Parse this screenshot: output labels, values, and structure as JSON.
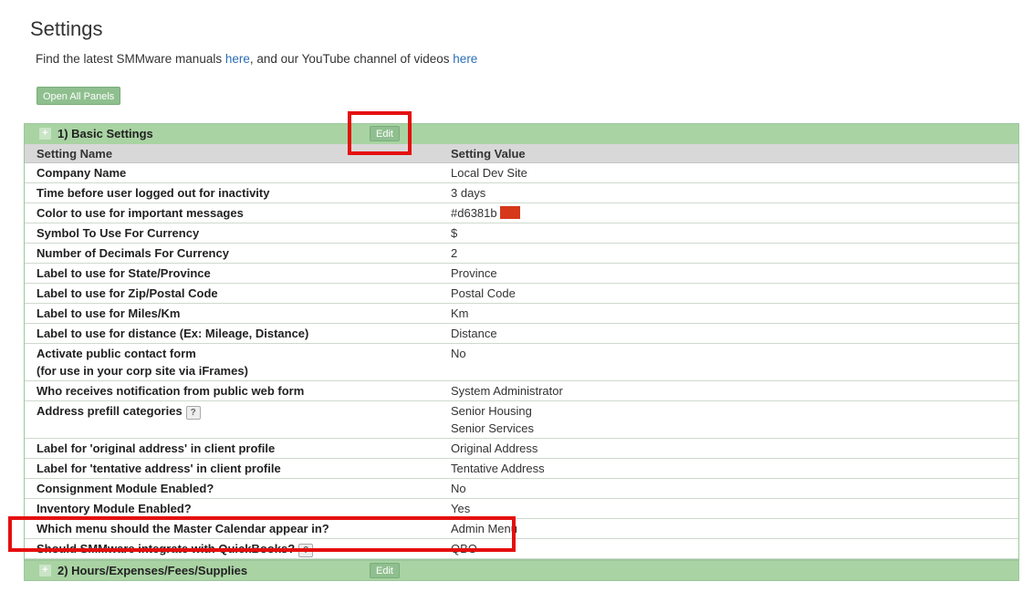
{
  "page": {
    "title": "Settings",
    "intro_text": "Find the latest SMMware manuals ",
    "link1": "here",
    "intro_mid": ", and our YouTube channel of videos ",
    "link2": "here",
    "open_all": "Open All Panels"
  },
  "panel1": {
    "title": "1) Basic Settings",
    "toggle": "+",
    "edit_label": "Edit",
    "col_name": "Setting Name",
    "col_value": "Setting Value",
    "rows": [
      {
        "name": "Company Name",
        "value": "Local Dev Site"
      },
      {
        "name": "Time before user logged out for inactivity",
        "value": "3 days"
      },
      {
        "name": "Color to use for important messages",
        "value": "#d6381b"
      },
      {
        "name": "Symbol To Use For Currency",
        "value": "$"
      },
      {
        "name": "Number of Decimals For Currency",
        "value": "2"
      },
      {
        "name": "Label to use for State/Province",
        "value": "Province"
      },
      {
        "name": "Label to use for Zip/Postal Code",
        "value": "Postal Code"
      },
      {
        "name": "Label to use for Miles/Km",
        "value": "Km"
      },
      {
        "name": "Label to use for distance (Ex: Mileage, Distance)",
        "value": "Distance"
      },
      {
        "name": "Activate public contact form",
        "name2": "(for use in your corp site via iFrames)",
        "value": "No"
      },
      {
        "name": "Who receives notification from public web form",
        "value": "System Administrator"
      },
      {
        "name": "Address prefill categories",
        "help": "?",
        "value": "Senior Housing",
        "value2": "Senior Services"
      },
      {
        "name": "Label for 'original address' in client profile",
        "value": "Original Address"
      },
      {
        "name": "Label for 'tentative address' in client profile",
        "value": "Tentative Address"
      },
      {
        "name": "Consignment Module Enabled?",
        "value": "No"
      },
      {
        "name": "Inventory Module Enabled?",
        "value": "Yes"
      },
      {
        "name": "Which menu should the Master Calendar appear in?",
        "value": "Admin Menu"
      },
      {
        "name": "Should SMMware integrate with QuickBooks?",
        "help": "?",
        "value": "QBO"
      }
    ]
  },
  "panel2": {
    "title": "2) Hours/Expenses/Fees/Supplies",
    "toggle": "+",
    "edit_label": "Edit"
  },
  "colors": {
    "important": "#d6381b",
    "highlight": "#e50f0f",
    "panel_header": "#a9d3a3"
  }
}
